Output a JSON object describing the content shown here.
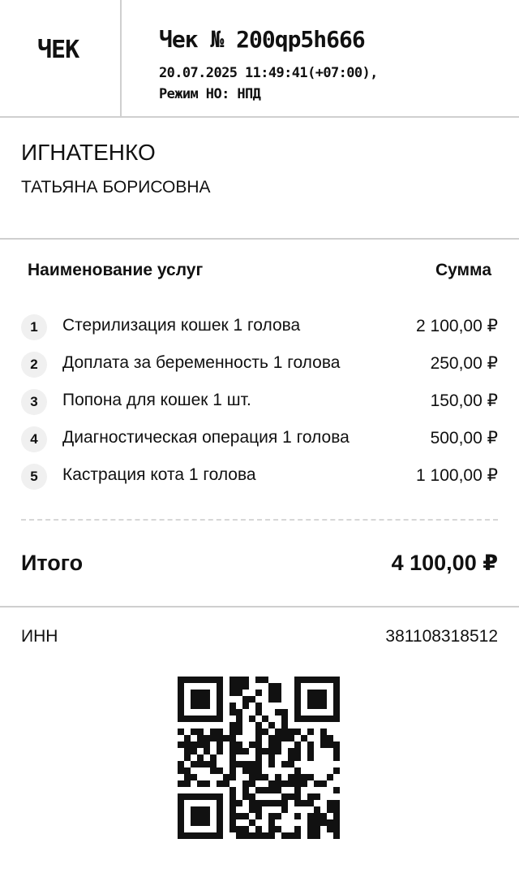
{
  "header": {
    "check_label": "ЧЕК",
    "title": "Чек № 200qp5h666",
    "datetime": "20.07.2025 11:49:41(+07:00),",
    "mode": "Режим НО: НПД"
  },
  "client": {
    "surname": "ИГНАТЕНКО",
    "name": "ТАТЬЯНА БОРИСОВНА"
  },
  "items": {
    "col_name": "Наименование услуг",
    "col_sum": "Сумма",
    "rows": [
      {
        "num": "1",
        "label": "Стерилизация кошек 1 голова",
        "amount": "2 100,00 ₽"
      },
      {
        "num": "2",
        "label": "Доплата за беременность 1 голова",
        "amount": "250,00 ₽"
      },
      {
        "num": "3",
        "label": "Попона для кошек 1 шт.",
        "amount": "150,00 ₽"
      },
      {
        "num": "4",
        "label": "Диагностическая операция 1 голова",
        "amount": "500,00 ₽"
      },
      {
        "num": "5",
        "label": "Кастрация кота 1 голова",
        "amount": "1 100,00 ₽"
      }
    ]
  },
  "total": {
    "label": "Итого",
    "amount": "4 100,00 ₽"
  },
  "inn": {
    "label": "ИНН",
    "value": "381108318512"
  },
  "icons": {
    "qr": "qr-code-icon"
  }
}
